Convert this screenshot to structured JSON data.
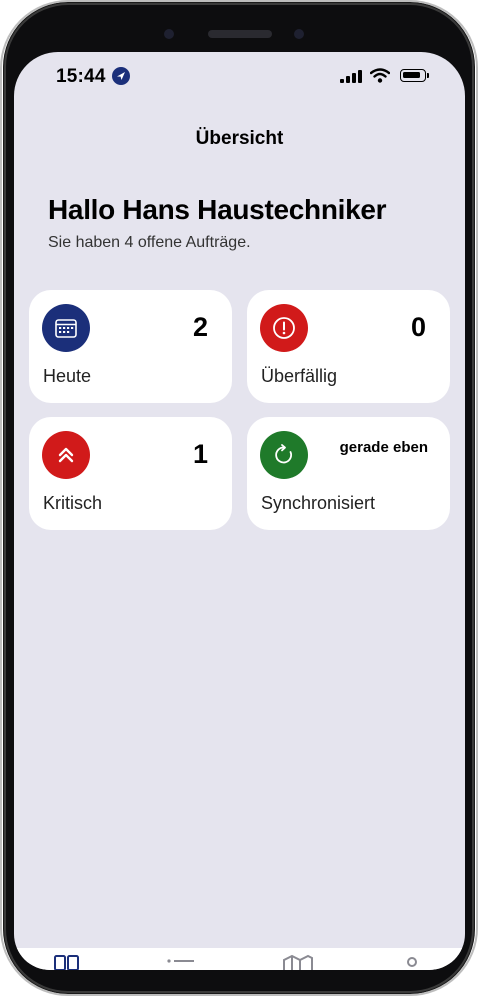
{
  "status_bar": {
    "time": "15:44"
  },
  "nav": {
    "title": "Übersicht"
  },
  "greeting": {
    "title": "Hallo Hans Haustechniker",
    "subtitle": "Sie haben 4 offene Aufträge."
  },
  "cards": [
    {
      "label": "Heute",
      "value": "2",
      "icon": "calendar-icon",
      "color": "#1b2f7a"
    },
    {
      "label": "Überfällig",
      "value": "0",
      "icon": "alert-icon",
      "color": "#d11a1a"
    },
    {
      "label": "Kritisch",
      "value": "1",
      "icon": "chevrons-up-icon",
      "color": "#d11a1a"
    },
    {
      "label": "Synchronisiert",
      "value": "gerade eben",
      "icon": "sync-icon",
      "color": "#1f7a2a"
    }
  ],
  "tabbar": {
    "icons": [
      "dashboard-icon",
      "list-icon",
      "map-icon",
      "profile-icon"
    ],
    "active_color": "#1b2f7a"
  }
}
